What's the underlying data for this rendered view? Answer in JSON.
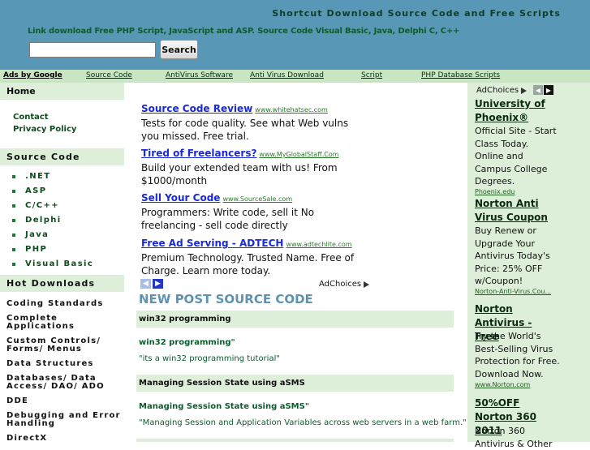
{
  "header": {
    "title": "Shortcut Download Source Code and Free Scripts",
    "tagline": "Link download Free PHP Script, JavaScript and ASP. Source Code Visual Basic, Java, Delphi C, C++",
    "search_value": "",
    "search_button": "Search"
  },
  "adbar": {
    "ads_by": "Ads by Google",
    "links": [
      "Source Code",
      "AntiVirus Software",
      "Anti Virus Download",
      "Script",
      "PHP Database Scripts"
    ]
  },
  "sidebar": {
    "home": "Home",
    "links": [
      "Contact",
      "Privacy Policy"
    ],
    "source_code_head": "Source Code",
    "source_code_items": [
      ".NET",
      "ASP",
      "C/C++",
      "Delphi",
      "Java",
      "PHP",
      "Visual Basic"
    ],
    "hot_head": "Hot Downloads",
    "hot_items": [
      "Coding Standards",
      "Complete Applications",
      "Custom Controls/ Forms/ Menus",
      "Data Structures",
      "Databases/ Data Access/ DAO/ ADO",
      "DDE",
      "Debugging and Error Handling",
      "DirectX"
    ]
  },
  "center_ads": [
    {
      "title": "Source Code Review",
      "url": "www.whitehatsec.com",
      "desc": "Tests for code quality. See what Web vulns you missed. Free trial."
    },
    {
      "title": "Tired of Freelancers?",
      "url": "www.MyGlobalStaff.Com",
      "desc": "Build your extended team with us! From $1000/month"
    },
    {
      "title": "Sell Your Code",
      "url": "www.SourceSale.com",
      "desc": "Programmers: Write code, sell it No freelancing - sell code directly"
    },
    {
      "title": "Free Ad Serving - ADTECH",
      "url": "www.adtechlite.com",
      "desc": "Premium Technology. Trusted Name. Free of Charge. Learn more today."
    }
  ],
  "adchoices": "AdChoices",
  "main": {
    "section_title": "NEW POST SOURCE CODE",
    "posts": [
      {
        "bar": "win32 programming",
        "link": "win32 programming\"",
        "desc": "\"its a win32 programming tutorial\""
      },
      {
        "bar": "Managing Session State using aSMS",
        "link": "Managing Session State using aSMS\"",
        "desc": "\"Managing Session and Application Variables across web servers in a web farm.\""
      }
    ]
  },
  "right_ads": [
    {
      "title": "University of Phoenix®",
      "desc": "Official Site - Start Class Today. Online and Campus College Degrees.",
      "url": "Phoenix.edu"
    },
    {
      "title": "Norton Anti Virus Coupon",
      "desc": "Buy Renew or Upgrade Your Antivirus Today's Price: 25% OFF w/Coupon!",
      "url": "Norton-Anti-Virus.Cou..."
    },
    {
      "title": "Norton Antivirus - Free",
      "desc": "Try the World's Best-Selling Virus Protection for Free. Download Now.",
      "url": "www.Norton.com"
    },
    {
      "title": "50%OFF Norton 360 2011",
      "desc": "Norton 360 Antivirus & Other",
      "url": ""
    }
  ],
  "colors": {
    "header_bg": "#5897b5",
    "sidebar_head_bg": "#ddefd9",
    "link_green": "#0d5c2e",
    "ad_blue": "#1a2ad8"
  }
}
